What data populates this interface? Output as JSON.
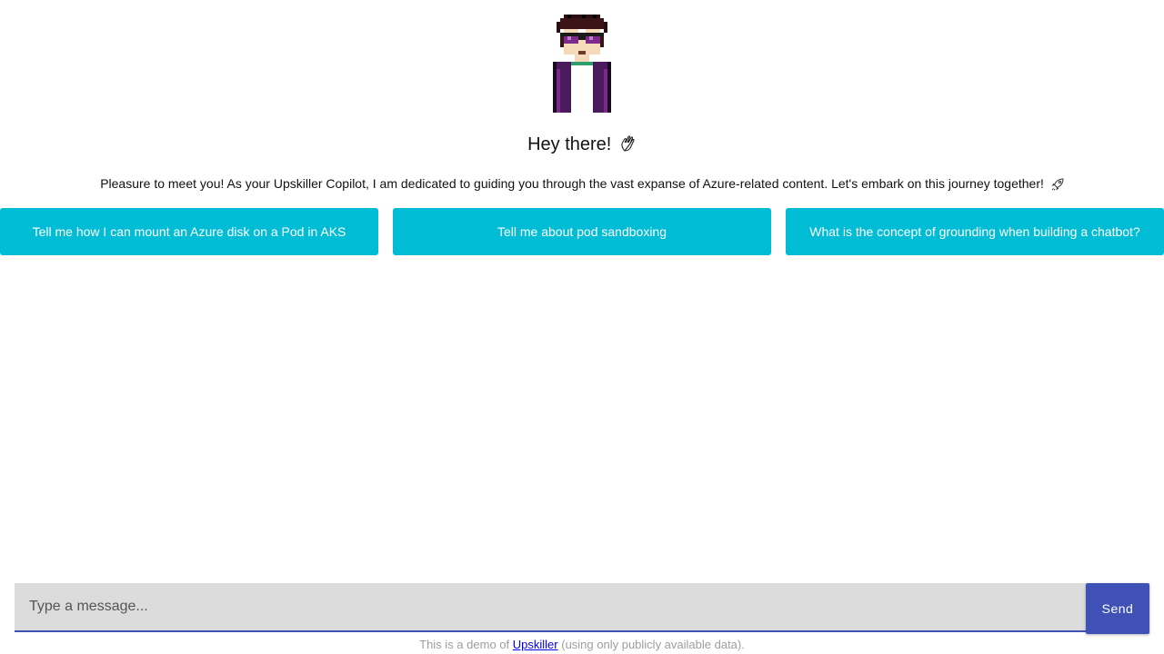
{
  "avatar": {
    "name": "avatar-icon"
  },
  "greeting": {
    "text": "Hey there!",
    "icon": "waving-hand-icon"
  },
  "intro": {
    "text": "Pleasure to meet you! As your Upskiller Copilot, I am dedicated to guiding you through the vast expanse of Azure-related content. Let's embark on this journey together!",
    "icon": "rocket-icon"
  },
  "suggestions": [
    {
      "label": "Tell me how I can mount an Azure disk on a Pod in AKS"
    },
    {
      "label": "Tell me about pod sandboxing"
    },
    {
      "label": "What is the concept of grounding when building a chatbot?"
    }
  ],
  "composer": {
    "placeholder": "Type a message...",
    "value": "",
    "send_label": "Send"
  },
  "footer": {
    "prefix": "This is a demo of",
    "link_text": "Upskiller",
    "suffix": " (using only publicly available data)."
  },
  "colors": {
    "accent": "#00bcd4",
    "primary": "#3f51b5",
    "input_bg": "#dcdcdc"
  }
}
